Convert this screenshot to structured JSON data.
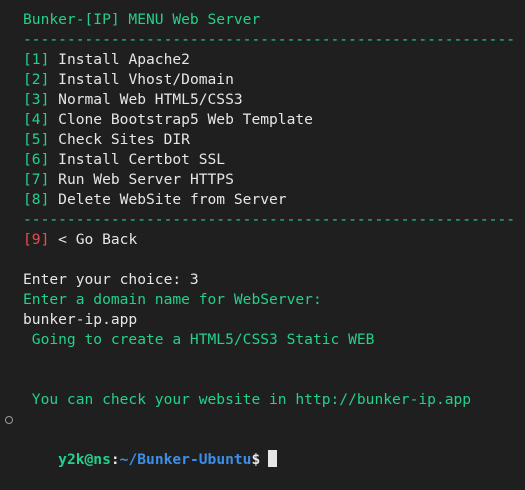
{
  "menu": {
    "title": "Bunker-[IP] MENU Web Server",
    "separator": "--------------------------------------------------------",
    "items": [
      {
        "num": "[1]",
        "label": "Install Apache2"
      },
      {
        "num": "[2]",
        "label": "Install Vhost/Domain"
      },
      {
        "num": "[3]",
        "label": "Normal Web HTML5/CSS3"
      },
      {
        "num": "[4]",
        "label": "Clone Bootstrap5 Web Template"
      },
      {
        "num": "[5]",
        "label": "Check Sites DIR"
      },
      {
        "num": "[6]",
        "label": "Install Certbot SSL"
      },
      {
        "num": "[7]",
        "label": "Run Web Server HTTPS"
      },
      {
        "num": "[8]",
        "label": "Delete WebSite from Server"
      }
    ],
    "back": {
      "num": "[9]",
      "label": "< Go Back"
    }
  },
  "session": {
    "choice_prompt": "Enter your choice: 3",
    "domain_prompt": "Enter a domain name for WebServer:",
    "domain_value": "bunker-ip.app",
    "creating_msg": " Going to create a HTML5/CSS3 Static WEB",
    "check_msg": " You can check your website in http://bunker-ip.app"
  },
  "prompt": {
    "user_host": "y2k@ns",
    "sep": ":",
    "path": "~/Bunker-Ubuntu",
    "dollar": "$"
  },
  "colors": {
    "background": "#1f1f1f",
    "green": "#23d18b",
    "red": "#f14c4c",
    "blue": "#3b8eea",
    "text": "#e6e6e6"
  }
}
